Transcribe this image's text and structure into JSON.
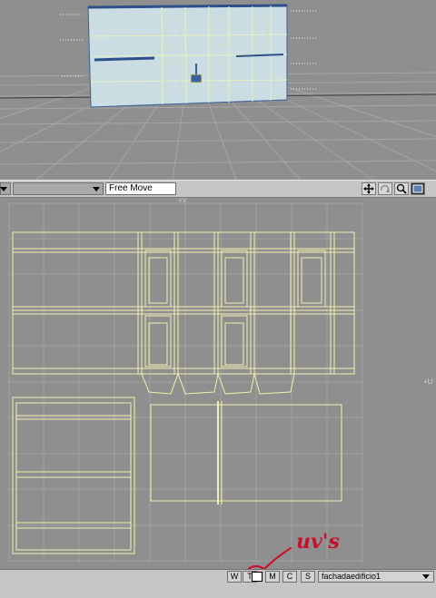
{
  "toolbar": {
    "mode_label": "Free Move"
  },
  "uv_view": {
    "axis_v_label": "+V",
    "axis_u_label": "+U"
  },
  "status_bar": {
    "buttons": [
      "W",
      "T",
      "M",
      "C",
      "S"
    ],
    "uv_map_name": "fachadaedificio1"
  },
  "annotation": {
    "text": "uv's",
    "color": "#c8102e"
  },
  "colors": {
    "wire": "#f2f0b0",
    "grid": "#a4a4a4",
    "viewport_bg": "#8f8f8f",
    "panel": "#c6c6c6"
  },
  "icons": [
    "move-icon",
    "rotate-icon",
    "zoom-icon",
    "fit-icon",
    "dropdown-arrow-icon"
  ]
}
